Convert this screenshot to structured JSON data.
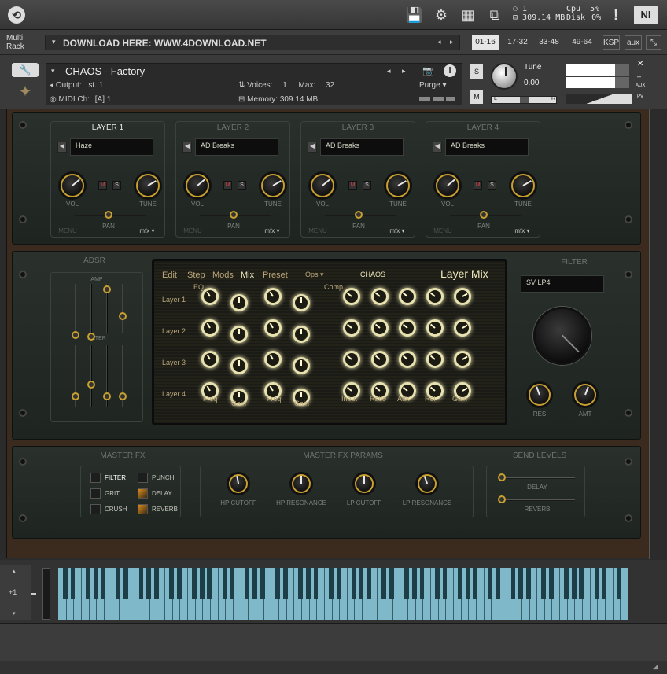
{
  "topbar": {
    "voices_icon": "voices-icon",
    "voices": "1",
    "memory": "309.14 MB",
    "cpu_label": "Cpu",
    "cpu_value": "5%",
    "disk_label": "Disk",
    "disk_value": "0%",
    "alert": "!",
    "ni_logo": "NI"
  },
  "rack": {
    "label_line1": "Multi",
    "label_line2": "Rack",
    "title": "DOWNLOAD HERE: WWW.4DOWNLOAD.NET",
    "tabs": [
      "01-16",
      "17-32",
      "33-48",
      "49-64",
      "KSP",
      "aux"
    ]
  },
  "instrument": {
    "name": "CHAOS - Factory",
    "output_label": "Output:",
    "output_value": "st. 1",
    "voices_label": "Voices:",
    "voices_value": "1",
    "max_label": "Max:",
    "max_value": "32",
    "midi_label": "MIDI Ch:",
    "midi_value": "[A]  1",
    "memory_label": "Memory:",
    "memory_value": "309.14 MB",
    "purge": "Purge",
    "tune_label": "Tune",
    "tune_value": "0.00",
    "s_btn": "S",
    "m_btn": "M",
    "pan_l": "L",
    "pan_r": "R",
    "aux": "AUX",
    "pv": "PV"
  },
  "layers": [
    {
      "title": "LAYER 1",
      "preset": "Haze",
      "active": true
    },
    {
      "title": "LAYER 2",
      "preset": "AD Breaks",
      "active": false
    },
    {
      "title": "LAYER 3",
      "preset": "AD Breaks",
      "active": false
    },
    {
      "title": "LAYER 4",
      "preset": "AD Breaks",
      "active": false
    }
  ],
  "layer_labels": {
    "vol": "VOL",
    "tune": "TUNE",
    "pan": "PAN",
    "menu": "MENU",
    "mfx": "mfx",
    "m": "M",
    "s": "S"
  },
  "adsr": {
    "title": "ADSR",
    "amp": "AMP",
    "filter": "FILTER"
  },
  "screen": {
    "tabs": [
      "Edit",
      "Step",
      "Mods",
      "Mix",
      "Preset"
    ],
    "active_tab": "Mix",
    "ops": "Ops",
    "chaos": "CHAOS",
    "title": "Layer Mix",
    "eq": "EQ",
    "comp": "Comp",
    "rows": [
      "Layer 1",
      "Layer 2",
      "Layer 3",
      "Layer 4"
    ],
    "eq_cols": [
      "Freq",
      "Gain",
      "Freq",
      "Gain"
    ],
    "comp_cols": [
      "Input",
      "Ratio",
      "Attk",
      "Rel",
      "Gain"
    ]
  },
  "filter": {
    "title": "FILTER",
    "type": "SV LP4",
    "res": "RES",
    "amt": "AMT"
  },
  "master_fx": {
    "title": "MASTER FX",
    "items": [
      {
        "label": "FILTER",
        "on": false
      },
      {
        "label": "PUNCH",
        "on": false
      },
      {
        "label": "GRIT",
        "on": false
      },
      {
        "label": "DELAY",
        "on": true
      },
      {
        "label": "CRUSH",
        "on": false
      },
      {
        "label": "REVERB",
        "on": true
      }
    ]
  },
  "master_params": {
    "title": "MASTER FX PARAMS",
    "knobs": [
      "HP CUTOFF",
      "HP RESONANCE",
      "LP CUTOFF",
      "LP RESONANCE"
    ]
  },
  "send_levels": {
    "title": "SEND LEVELS",
    "delay": "DELAY",
    "reverb": "REVERB"
  },
  "keyboard": {
    "octave": "+1"
  }
}
